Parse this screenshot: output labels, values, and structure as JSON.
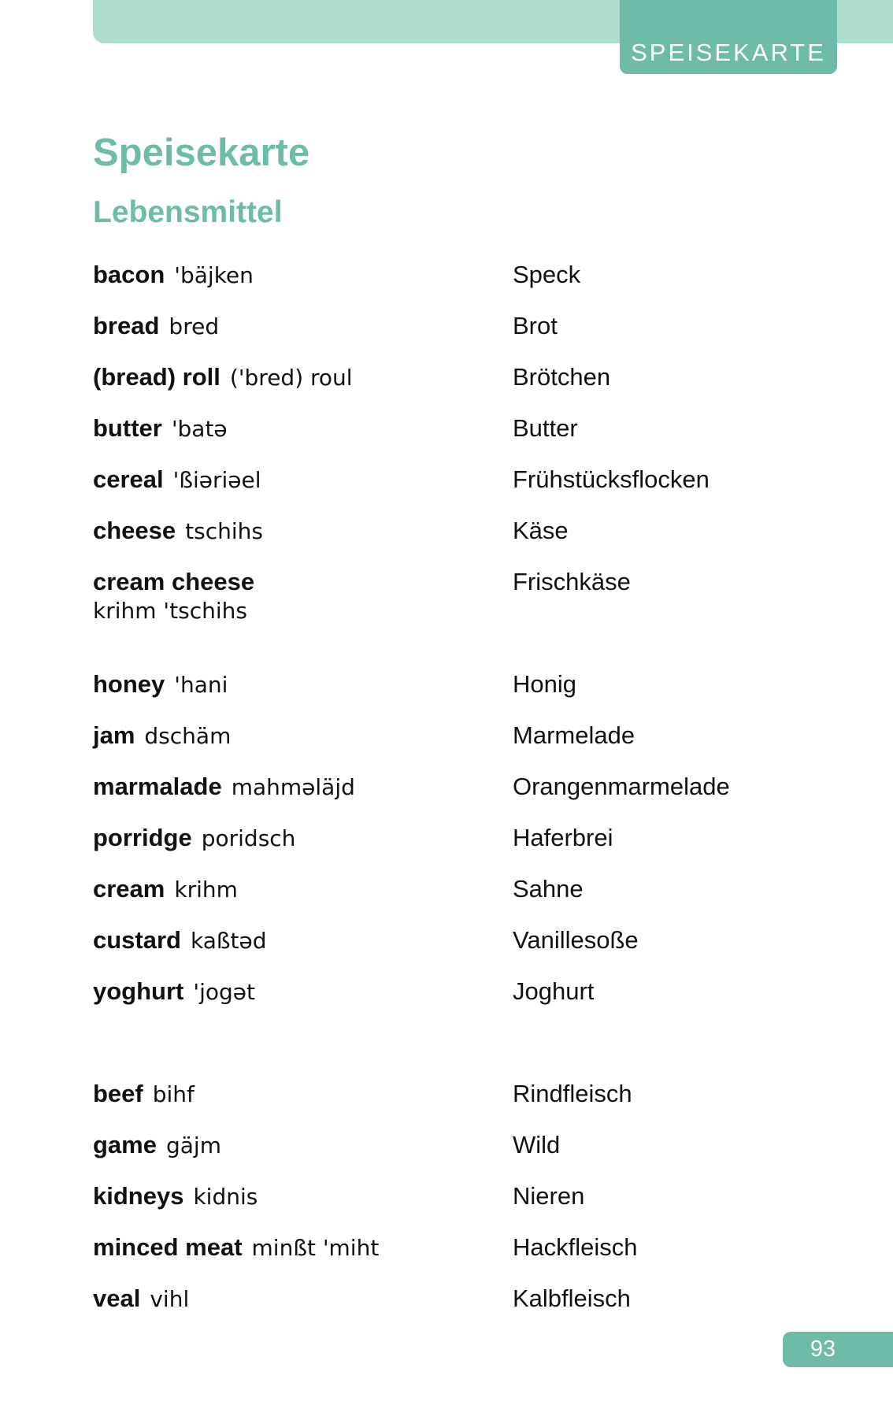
{
  "header": {
    "section_tab": "SPEISEKARTE"
  },
  "page_title": "Speisekarte",
  "section_subtitle": "Lebensmittel",
  "entries": [
    {
      "word": "bacon",
      "pron": "'bäjken",
      "translation": "Speck"
    },
    {
      "word": "bread",
      "pron": "bred",
      "translation": "Brot"
    },
    {
      "word": "(bread) roll",
      "pron": "('bred) roul",
      "translation": "Brötchen"
    },
    {
      "word": "butter",
      "pron": "'batə",
      "translation": "Butter"
    },
    {
      "word": "cereal",
      "pron": "'ßiəriəel",
      "translation": "Frühstücksflocken"
    },
    {
      "word": "cheese",
      "pron": "tschihs",
      "translation": "Käse"
    },
    {
      "word": "cream cheese",
      "pron": "krihm 'tschihs",
      "translation": "Frischkäse"
    },
    {
      "word": "honey",
      "pron": "'hani",
      "translation": "Honig"
    },
    {
      "word": "jam",
      "pron": "dschäm",
      "translation": "Marmelade"
    },
    {
      "word": "marmalade",
      "pron": "mahməläjd",
      "translation": "Orangenmarmelade"
    },
    {
      "word": "porridge",
      "pron": "poridsch",
      "translation": "Haferbrei"
    },
    {
      "word": "cream",
      "pron": "krihm",
      "translation": "Sahne"
    },
    {
      "word": "custard",
      "pron": "kaßtəd",
      "translation": "Vanillesoße"
    },
    {
      "word": "yoghurt",
      "pron": "'jogət",
      "translation": "Joghurt"
    },
    {
      "word": "beef",
      "pron": "bihf",
      "translation": "Rindfleisch"
    },
    {
      "word": "game",
      "pron": "gäjm",
      "translation": "Wild"
    },
    {
      "word": "kidneys",
      "pron": "kidnis",
      "translation": "Nieren"
    },
    {
      "word": "minced meat",
      "pron": "minßt 'miht",
      "translation": "Hackfleisch"
    },
    {
      "word": "veal",
      "pron": "vihl",
      "translation": "Kalbfleisch"
    }
  ],
  "page_number": "93",
  "colors": {
    "accent": "#6dbba8",
    "accent_light": "#aedccf",
    "text": "#111111"
  }
}
